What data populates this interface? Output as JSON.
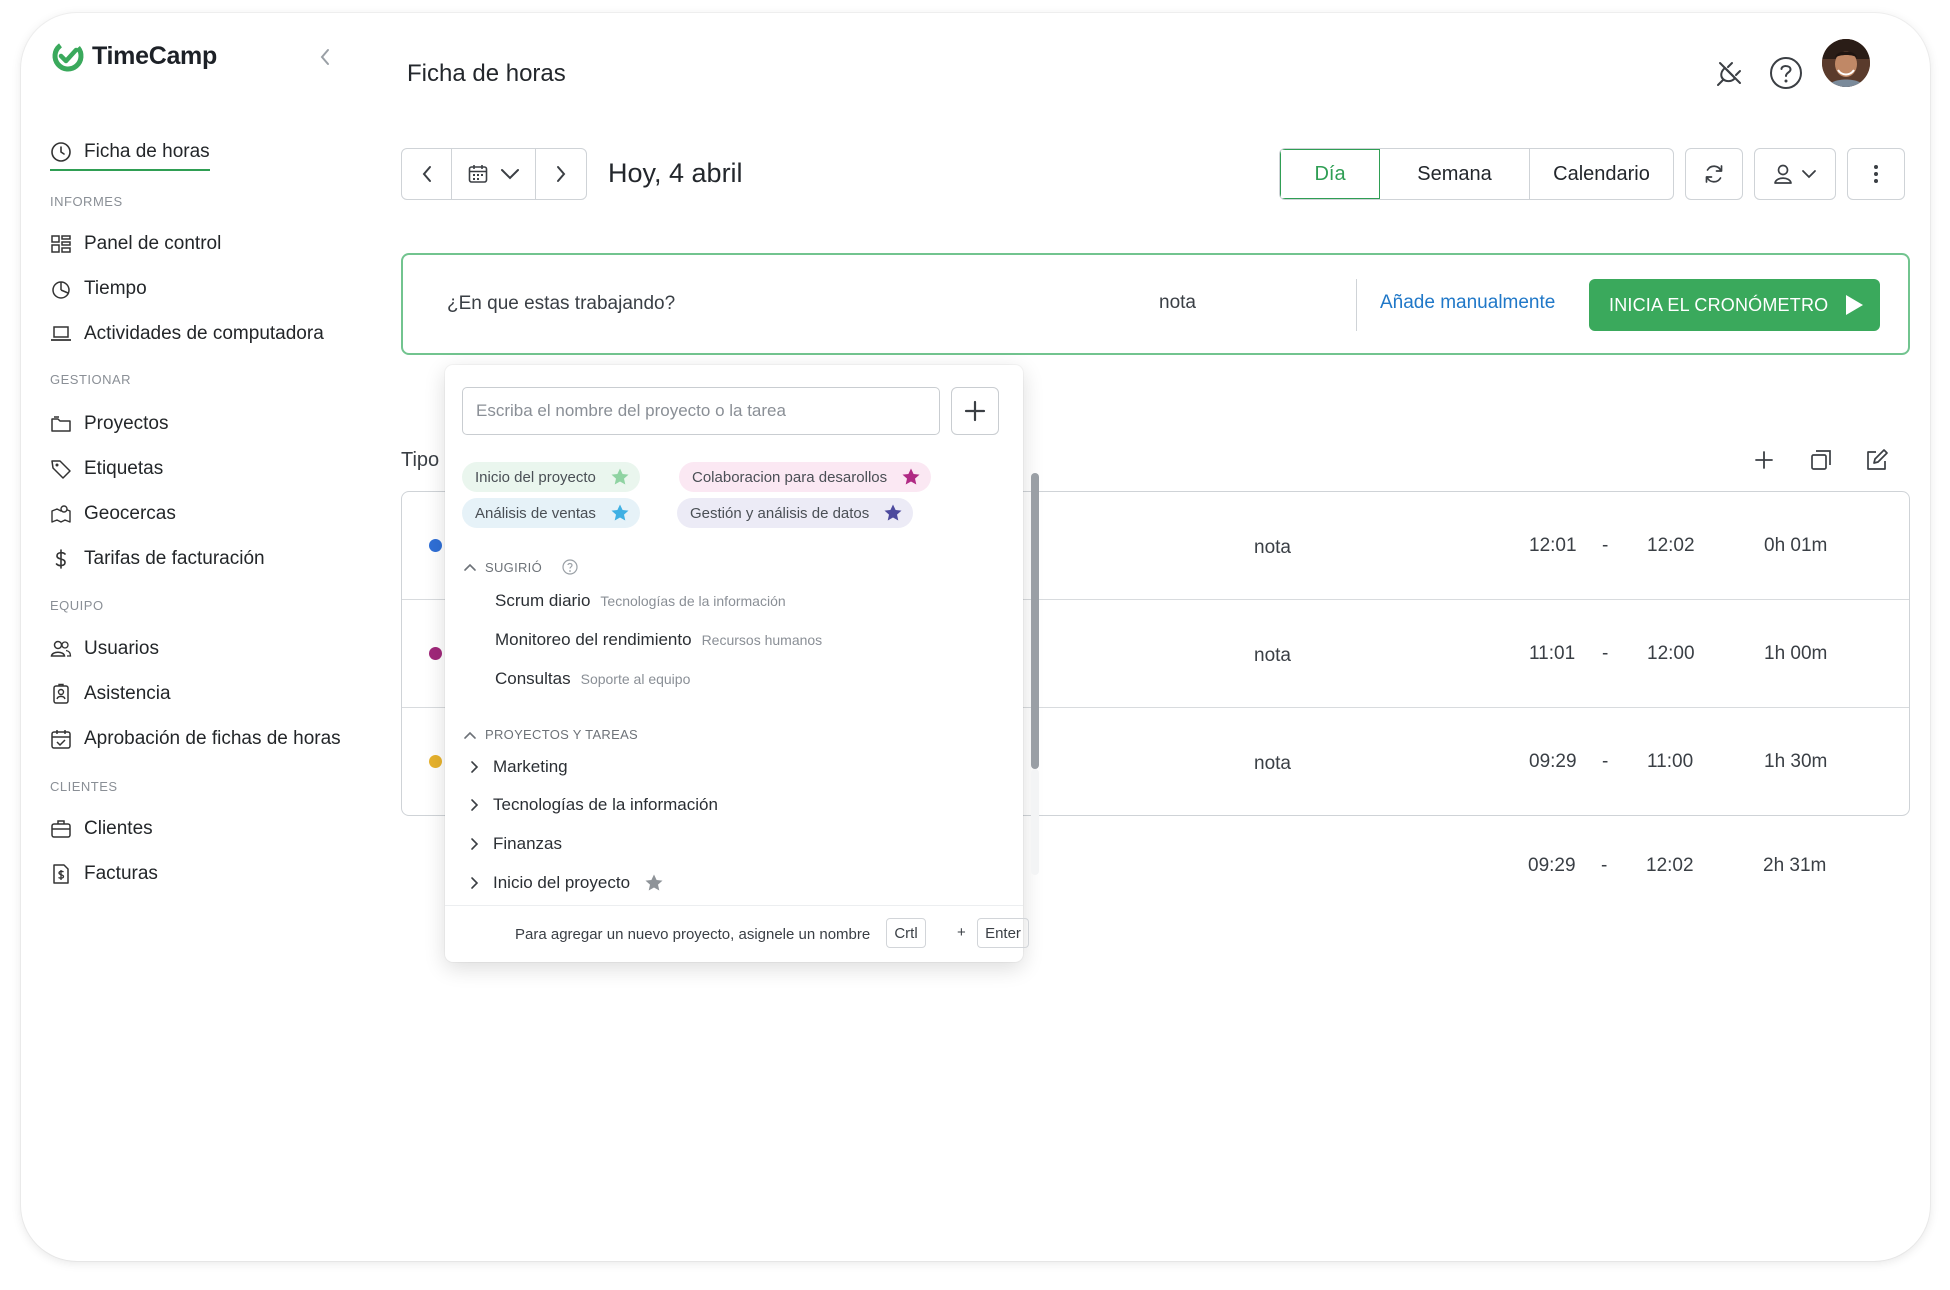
{
  "app": {
    "name": "TimeCamp",
    "page_title": "Ficha de horas",
    "colors": {
      "brand": "#3aa95c",
      "link": "#2078c8"
    }
  },
  "sidebar": {
    "active": {
      "label": "Ficha de horas",
      "icon": "clock-icon"
    },
    "sections": [
      {
        "title": "INFORMES",
        "items": [
          {
            "label": "Panel de control",
            "icon": "dashboard-icon"
          },
          {
            "label": "Tiempo",
            "icon": "pie-chart-icon"
          },
          {
            "label": "Actividades de computadora",
            "icon": "laptop-icon"
          }
        ]
      },
      {
        "title": "GESTIONAR",
        "items": [
          {
            "label": "Proyectos",
            "icon": "folder-icon"
          },
          {
            "label": "Etiquetas",
            "icon": "tag-icon"
          },
          {
            "label": "Geocercas",
            "icon": "map-icon"
          },
          {
            "label": "Tarifas de facturación",
            "icon": "dollar-icon"
          }
        ]
      },
      {
        "title": "EQUIPO",
        "items": [
          {
            "label": "Usuarios",
            "icon": "users-icon"
          },
          {
            "label": "Asistencia",
            "icon": "badge-icon"
          },
          {
            "label": "Aprobación de fichas de horas",
            "icon": "calendar-check-icon"
          }
        ]
      },
      {
        "title": "CLIENTES",
        "items": [
          {
            "label": "Clientes",
            "icon": "briefcase-icon"
          },
          {
            "label": "Facturas",
            "icon": "invoice-icon"
          }
        ]
      }
    ]
  },
  "toolbar": {
    "date_label": "Hoy, 4 abril",
    "views": [
      "Día",
      "Semana",
      "Calendario"
    ],
    "selected_view": "Día"
  },
  "timer": {
    "question": "¿En que estas trabajando?",
    "note": "nota",
    "manual_link": "Añade manualmente",
    "start_button": "INICIA EL CRONÓMETRO"
  },
  "entries": {
    "header_label": "Tipo",
    "rows": [
      {
        "color": "#2f6fd6",
        "note": "nota",
        "start": "12:01",
        "sep": "-",
        "end": "12:02",
        "duration": "0h 01m"
      },
      {
        "color": "#a0287a",
        "note": "nota",
        "start": "11:01",
        "sep": "-",
        "end": "12:00",
        "duration": "1h 00m"
      },
      {
        "color": "#e7b22d",
        "note": "nota",
        "start": "09:29",
        "sep": "-",
        "end": "11:00",
        "duration": "1h 30m"
      }
    ],
    "total": {
      "start": "09:29",
      "sep": "-",
      "end": "12:02",
      "duration": "2h 31m"
    }
  },
  "dropdown": {
    "search_placeholder": "Escriba el nombre del proyecto o la tarea",
    "favorites": [
      {
        "label": "Inicio del proyecto",
        "bg": "#eaf6ee",
        "star": "#8fd3a2"
      },
      {
        "label": "Colaboracion para desarollos",
        "bg": "#fbe8f3",
        "star": "#b02a84"
      },
      {
        "label": "Análisis de ventas",
        "bg": "#e6f2f8",
        "star": "#3fb0e3"
      },
      {
        "label": "Gestión y análisis de datos",
        "bg": "#ecebf6",
        "star": "#4d4a9e"
      }
    ],
    "suggested_title": "SUGIRIÓ",
    "suggested": [
      {
        "name": "Scrum diario",
        "category": "Tecnologías de la información"
      },
      {
        "name": "Monitoreo del rendimiento",
        "category": "Recursos humanos"
      },
      {
        "name": "Consultas",
        "category": "Soporte al equipo"
      }
    ],
    "projects_title": "PROYECTOS Y TAREAS",
    "projects": [
      "Marketing",
      "Tecnologías de la información",
      "Finanzas",
      "Inicio del proyecto"
    ],
    "footer_hint": "Para agregar un nuevo proyecto, asignele un nombre",
    "footer_key1": "Crtl",
    "footer_plus": "+",
    "footer_key2": "Enter"
  }
}
